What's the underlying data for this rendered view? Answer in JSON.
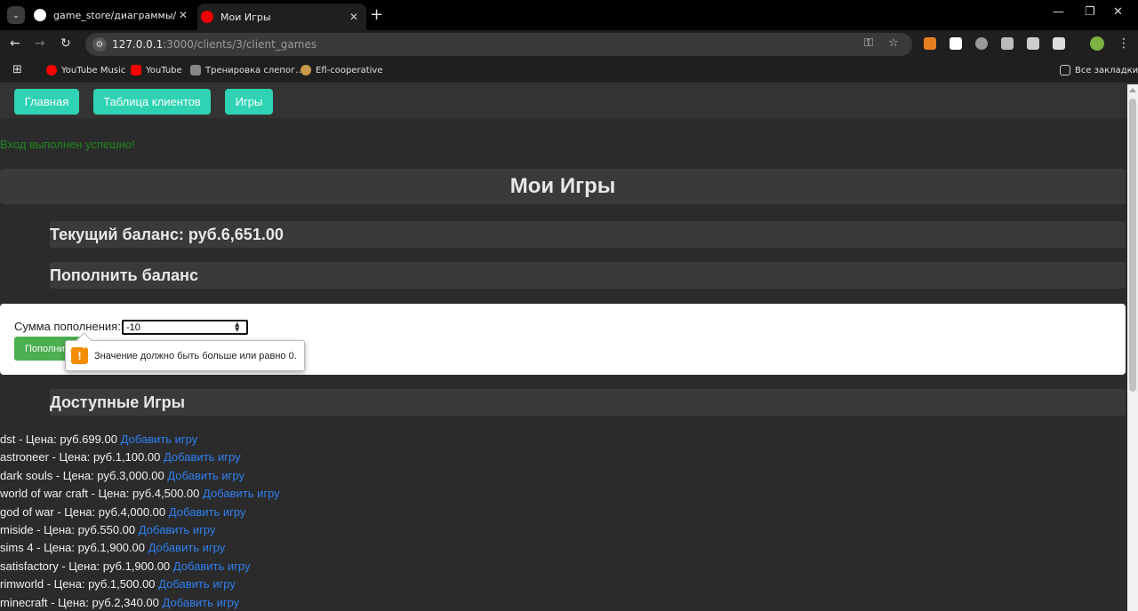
{
  "browser": {
    "tabs": [
      {
        "title": "game_store/диаграммы/ER_DI",
        "icon": "github-icon",
        "active": false
      },
      {
        "title": "Мои Игры",
        "icon": "red-circle-icon",
        "active": true
      }
    ],
    "url_host": "127.0.0.1",
    "url_path": ":3000/clients/3/client_games",
    "bookmarks": [
      "YouTube Music",
      "YouTube",
      "Тренировка слепог...",
      "Efl-cooperative"
    ],
    "all_bookmarks": "Все закладки"
  },
  "nav": {
    "home": "Главная",
    "clients": "Таблица клиентов",
    "games": "Игры"
  },
  "flash": "Вход выполнен успешно!",
  "page_title": "Мои Игры",
  "balance_heading": "Текущий баланс: руб.6,651.00",
  "topup_heading": "Пополнить баланс",
  "topup_form": {
    "label": "Сумма пополнения:",
    "value": "-10",
    "submit": "Пополнить",
    "validation_message": "Значение должно быть больше или равно 0."
  },
  "available_heading": "Доступные Игры",
  "add_label": "Добавить игру",
  "games": [
    "dst - Цена: руб.699.00",
    "astroneer - Цена: руб.1,100.00",
    "dark souls - Цена: руб.3,000.00",
    "world of war craft - Цена: руб.4,500.00",
    "god of war - Цена: руб.4,000.00",
    "miside - Цена: руб.550.00",
    "sims 4 - Цена: руб.1,900.00",
    "satisfactory - Цена: руб.1,900.00",
    "rimworld - Цена: руб.1,500.00",
    "minecraft - Цена: руб.2,340.00"
  ]
}
